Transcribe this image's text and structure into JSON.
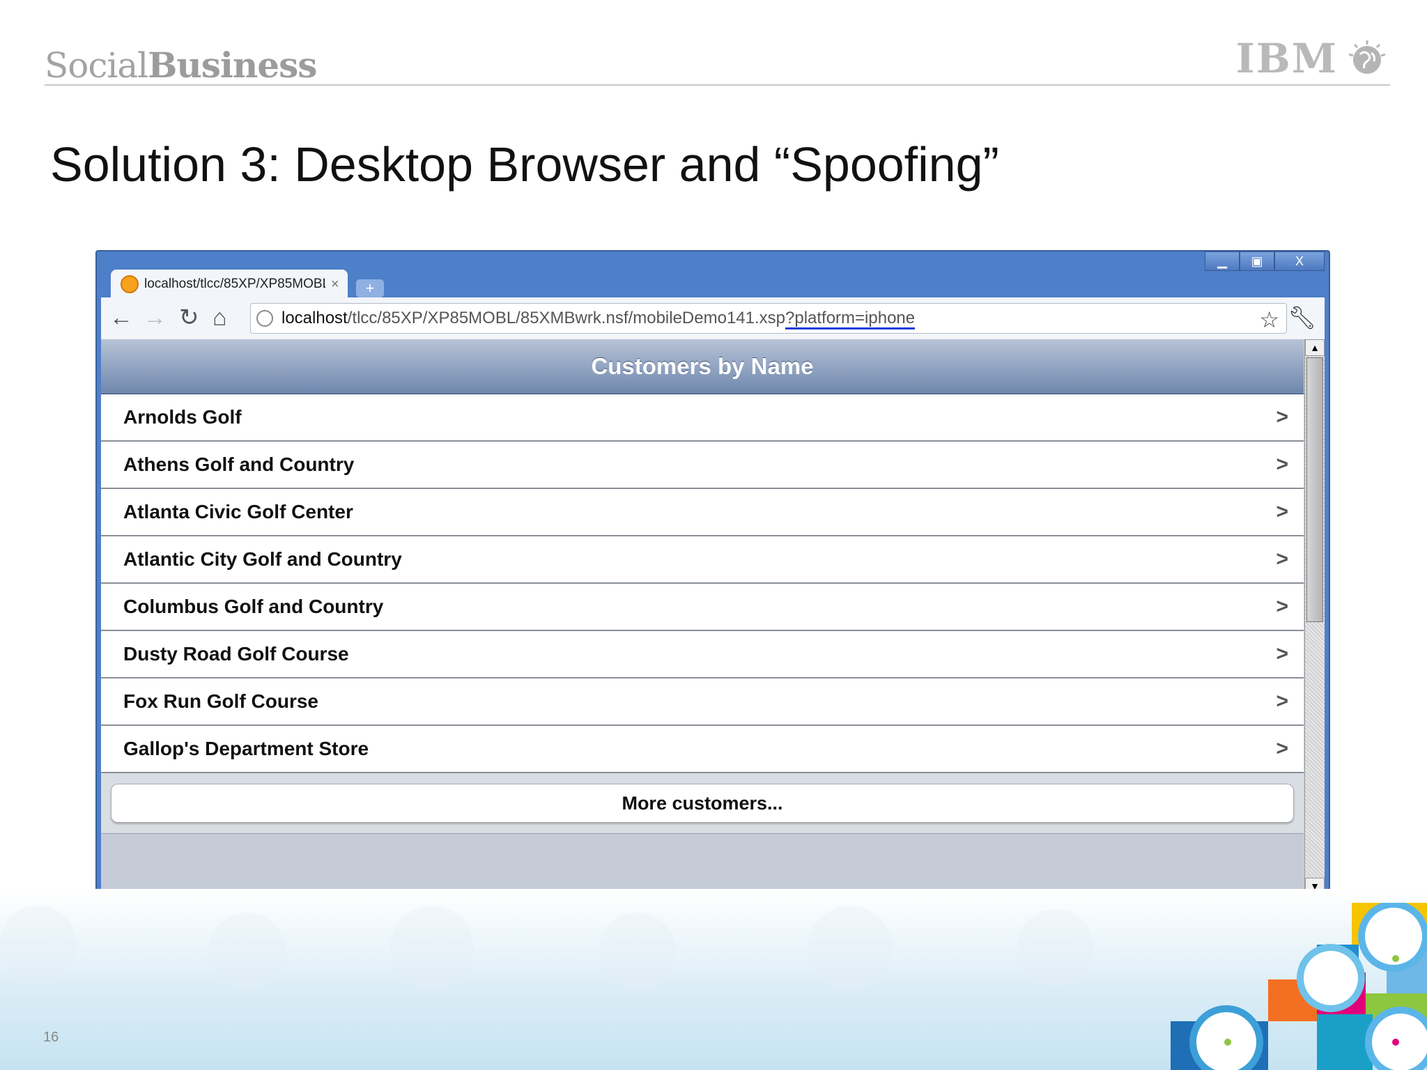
{
  "header": {
    "brand_light": "Social",
    "brand_bold": "Business",
    "ibm_logo": "IBM"
  },
  "slide": {
    "title": "Solution 3:  Desktop Browser and “Spoofing”",
    "page_number": "16"
  },
  "browser": {
    "tab_title": "localhost/tlcc/85XP/XP85MOBL",
    "url_host": "localhost",
    "url_path": "/tlcc/85XP/XP85MOBL/85XMBwrk.nsf/mobileDemo141.xsp",
    "url_query": "?platform=iphone",
    "icons": {
      "back": "back-arrow-icon",
      "forward": "forward-arrow-icon",
      "reload": "reload-icon",
      "home": "home-icon",
      "bookmark": "star-icon",
      "settings": "wrench-icon"
    }
  },
  "app": {
    "header_title": "Customers by Name",
    "customers": [
      "Arnolds Golf",
      "Athens Golf and Country",
      "Atlanta Civic Golf Center",
      "Atlantic City Golf and Country",
      "Columbus Golf and Country",
      "Dusty Road Golf Course",
      "Fox Run Golf Course",
      "Gallop's Department Store"
    ],
    "more_label": "More customers..."
  },
  "colors": {
    "window_frame": "#4e7fc9",
    "header_gradient_top": "#b7c3d7",
    "header_gradient_bottom": "#6f87ad",
    "url_highlight": "#1a3bd8"
  }
}
